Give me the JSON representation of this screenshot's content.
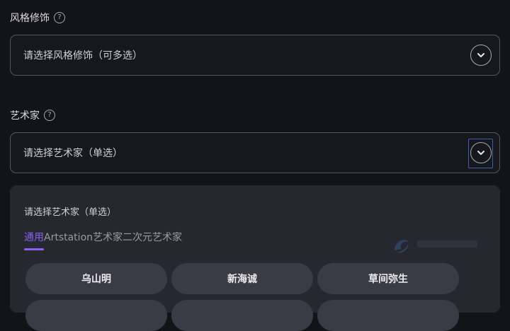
{
  "style_field": {
    "label": "风格修饰",
    "help_glyph": "?",
    "placeholder": "请选择风格修饰（可多选）"
  },
  "artist_field": {
    "label": "艺术家",
    "help_glyph": "?",
    "placeholder": "请选择艺术家（单选）"
  },
  "dropdown": {
    "title": "请选择艺术家（单选）",
    "tabs": [
      {
        "label": "通用",
        "active": true
      },
      {
        "label": "Artstation艺术家",
        "active": false
      },
      {
        "label": "二次元艺术家",
        "active": false
      }
    ],
    "artists": [
      "乌山明",
      "新海诚",
      "草间弥生"
    ]
  },
  "colors": {
    "accent": "#8b62f0",
    "focus_ring": "#3a5ea8",
    "background": "#131418",
    "panel": "#26272f"
  },
  "icons": {
    "chevron": "chevron-down-icon",
    "help": "help-circle-icon"
  }
}
